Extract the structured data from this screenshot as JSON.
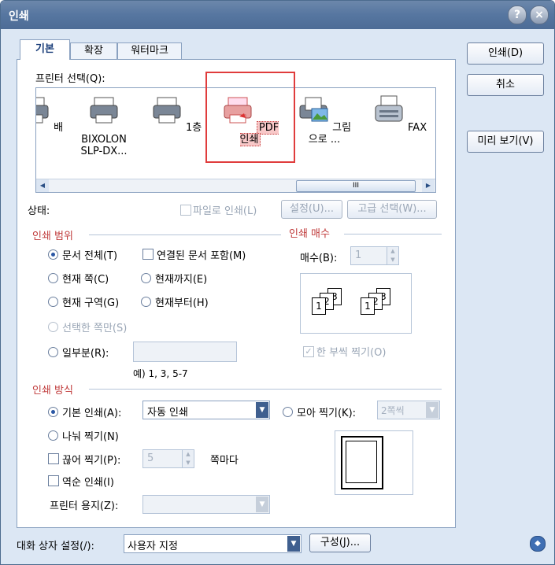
{
  "title": "인쇄",
  "buttons": {
    "print": "인쇄(D)",
    "cancel": "취소",
    "preview": "미리 보기(V)",
    "config": "구성(J)..."
  },
  "tabs": [
    "기본",
    "확장",
    "워터마크"
  ],
  "printer_select_label": "프린터 선택(Q):",
  "printers": [
    {
      "name": "배"
    },
    {
      "name": "BIXOLON SLP-DX..."
    },
    {
      "name": "1층"
    },
    {
      "name": "PDF 인쇄"
    },
    {
      "name": "그림으로 ..."
    },
    {
      "name": "FAX"
    }
  ],
  "status_label": "상태:",
  "print_to_file": "파일로 인쇄(L)",
  "settings_btn": "설정(U)...",
  "advanced_btn": "고급 선택(W)...",
  "range": {
    "title": "인쇄 범위",
    "whole": "문서 전체(T)",
    "linked": "연결된 문서 포함(M)",
    "current_page": "현재 쪽(C)",
    "to_current": "현재까지(E)",
    "current_section": "현재 구역(G)",
    "from_current": "현재부터(H)",
    "selection": "선택한 쪽만(S)",
    "partial": "일부분(R):",
    "example": "예) 1, 3, 5-7"
  },
  "copies": {
    "title": "인쇄 매수",
    "label": "매수(B):",
    "value": "1",
    "collate": "한 부씩 찍기(O)"
  },
  "method": {
    "title": "인쇄 방식",
    "basic": "기본 인쇄(A):",
    "basic_value": "자동 인쇄",
    "gather": "모아 찍기(K):",
    "gather_value": "2쪽씩",
    "divide": "나눠 찍기(N)",
    "cut": "끊어 찍기(P):",
    "cut_value": "5",
    "per_page": "쪽마다",
    "reverse": "역순 인쇄(I)",
    "paper": "프린터 용지(Z):"
  },
  "dialog_settings": {
    "label": "대화 상자 설정(/):",
    "value": "사용자 지정"
  },
  "colors": {
    "title_bar": "#5676a0",
    "section_title": "#c03c3c",
    "highlight_box": "#e03c3c"
  }
}
